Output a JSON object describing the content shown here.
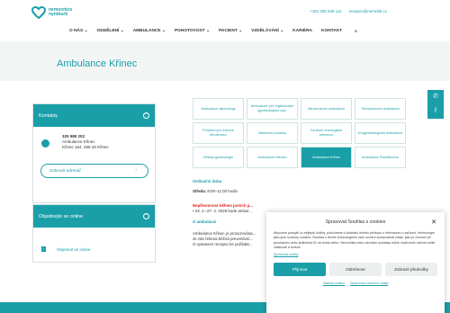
{
  "header": {
    "logo_text": [
      "nemocnice",
      "nymburk"
    ],
    "phone": "+420 325 535 111",
    "email": "recepce@nemnbk.cz"
  },
  "nav": [
    "O NÁS ⌄",
    "ODDĚLENÍ ⌄",
    "AMBULANCE ⌄",
    "POHOTOVOST ⌄",
    "PACIENT ⌄",
    "VZDĚLÁVÁNÍ ⌄",
    "KARIÉRA",
    "KONTAKT"
  ],
  "page_title": "Ambulance Křinec",
  "kontakty": {
    "title": "Kontakty",
    "phone": "325 589 202",
    "name": "Ambulance Křinec",
    "address": "Křinec 164, 289 33 Křinec",
    "button": "Zobrazit adresář"
  },
  "objednejte": {
    "title": "Objednejte se online",
    "link": "Objednat se online"
  },
  "tiles": [
    "Ambulance alkohology",
    "Ambulance pro registrované gynekologické pac.",
    "Ultrazvuková ambulance",
    "Tělovýchovná ambulance",
    "",
    "Poradna pro rizikové těhotenství",
    "Nádorové poradny",
    "Centrum onkologické prevence",
    "Urogynekologická ambulance",
    "",
    "Dětská gynekologie",
    "Ambulance Městec",
    "Ambulance Křinec",
    "Ambulance Rožďalovice",
    ""
  ],
  "content": {
    "ordinacni": "Ordinační doba",
    "streda": "Středa:",
    "streda_hod": "8:00–11:00 hodin",
    "nepritomnost": "Nepřítomnost během jarních p...",
    "nepritomnost_detail": "• 23. 2.–27. 2. 2026 bude ambul...",
    "o_ambulanci": "O ambulanci",
    "text1": "Ambulance Křinec je provozována...",
    "text2": "Je zde řešena běžná preventivní...",
    "text3": "O vystavení receptu lze požádat..."
  },
  "cookie": {
    "title": "Spravovat Souhlas s cookies",
    "text": "Abychom poskytli co nejlepší služby, používáme k ukládání a/nebo přístupu k informacím o zařízení, technologie jako jsou soubory cookies. Souhlas s těmito technologiemi nám umožní zpracovávat údaje, jako je chování při procházení nebo jedinečná ID na tomto webu. Nesouhlas nebo odvolání souhlasu může nepříznivě ovlivnit určité vlastnosti a funkce.",
    "manage": "Spravovat služby",
    "accept": "Přijmout",
    "deny": "Odmítnout",
    "prefs": "Zobrazit předvolby",
    "policy1": "Zásady cookies",
    "policy2": "Zpracování osobních údajů"
  },
  "colors": {
    "accent": "#1a9fa8",
    "alert": "#dd2222"
  }
}
